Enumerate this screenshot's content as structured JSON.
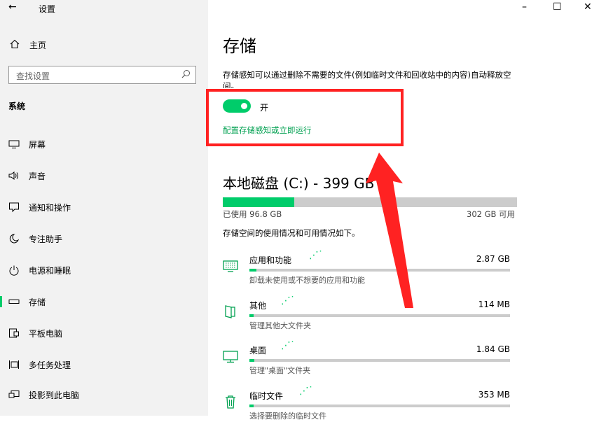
{
  "window": {
    "title": "设置",
    "back_glyph": "←",
    "minimize": "–",
    "maximize": "☐",
    "close": "✕"
  },
  "sidebar": {
    "home_label": "主页",
    "search_placeholder": "查找设置",
    "section_label": "系统",
    "items": [
      {
        "label": "屏幕",
        "icon": "monitor-icon"
      },
      {
        "label": "声音",
        "icon": "speaker-icon"
      },
      {
        "label": "通知和操作",
        "icon": "notification-icon"
      },
      {
        "label": "专注助手",
        "icon": "moon-icon"
      },
      {
        "label": "电源和睡眠",
        "icon": "power-icon"
      },
      {
        "label": "存储",
        "icon": "storage-icon",
        "active": true
      },
      {
        "label": "平板电脑",
        "icon": "tablet-icon"
      },
      {
        "label": "多任务处理",
        "icon": "multitask-icon"
      },
      {
        "label": "投影到此电脑",
        "icon": "project-icon"
      }
    ]
  },
  "main": {
    "title": "存储",
    "description": "存储感知可以通过删除不需要的文件(例如临时文件和回收站中的内容)自动释放空间。",
    "toggle_state": "开",
    "toggle_on": true,
    "configure_link": "配置存储感知或立即运行",
    "disk_title": "本地磁盘 (C:) - 399 GB",
    "used_label": "已使用 96.8 GB",
    "available_label": "302 GB 可用",
    "used_fraction": 0.243,
    "usage_description": "存储空间的使用情况和可用情况如下。",
    "categories": [
      {
        "name": "应用和功能",
        "size": "2.87 GB",
        "sub": "卸载未使用或不想要的应用和功能",
        "icon": "apps-icon",
        "fraction": 0.028
      },
      {
        "name": "其他",
        "size": "114 MB",
        "sub": "管理其他大文件夹",
        "icon": "other-icon",
        "fraction": 0.005
      },
      {
        "name": "桌面",
        "size": "1.84 GB",
        "sub": "管理\"桌面\"文件夹",
        "icon": "desktop-icon",
        "fraction": 0.02
      },
      {
        "name": "临时文件",
        "size": "353 MB",
        "sub": "选择要删除的临时文件",
        "icon": "trash-icon",
        "fraction": 0.005
      }
    ]
  },
  "colors": {
    "accent": "#00cc6a",
    "highlight": "#ff2222",
    "link": "#00a050"
  }
}
